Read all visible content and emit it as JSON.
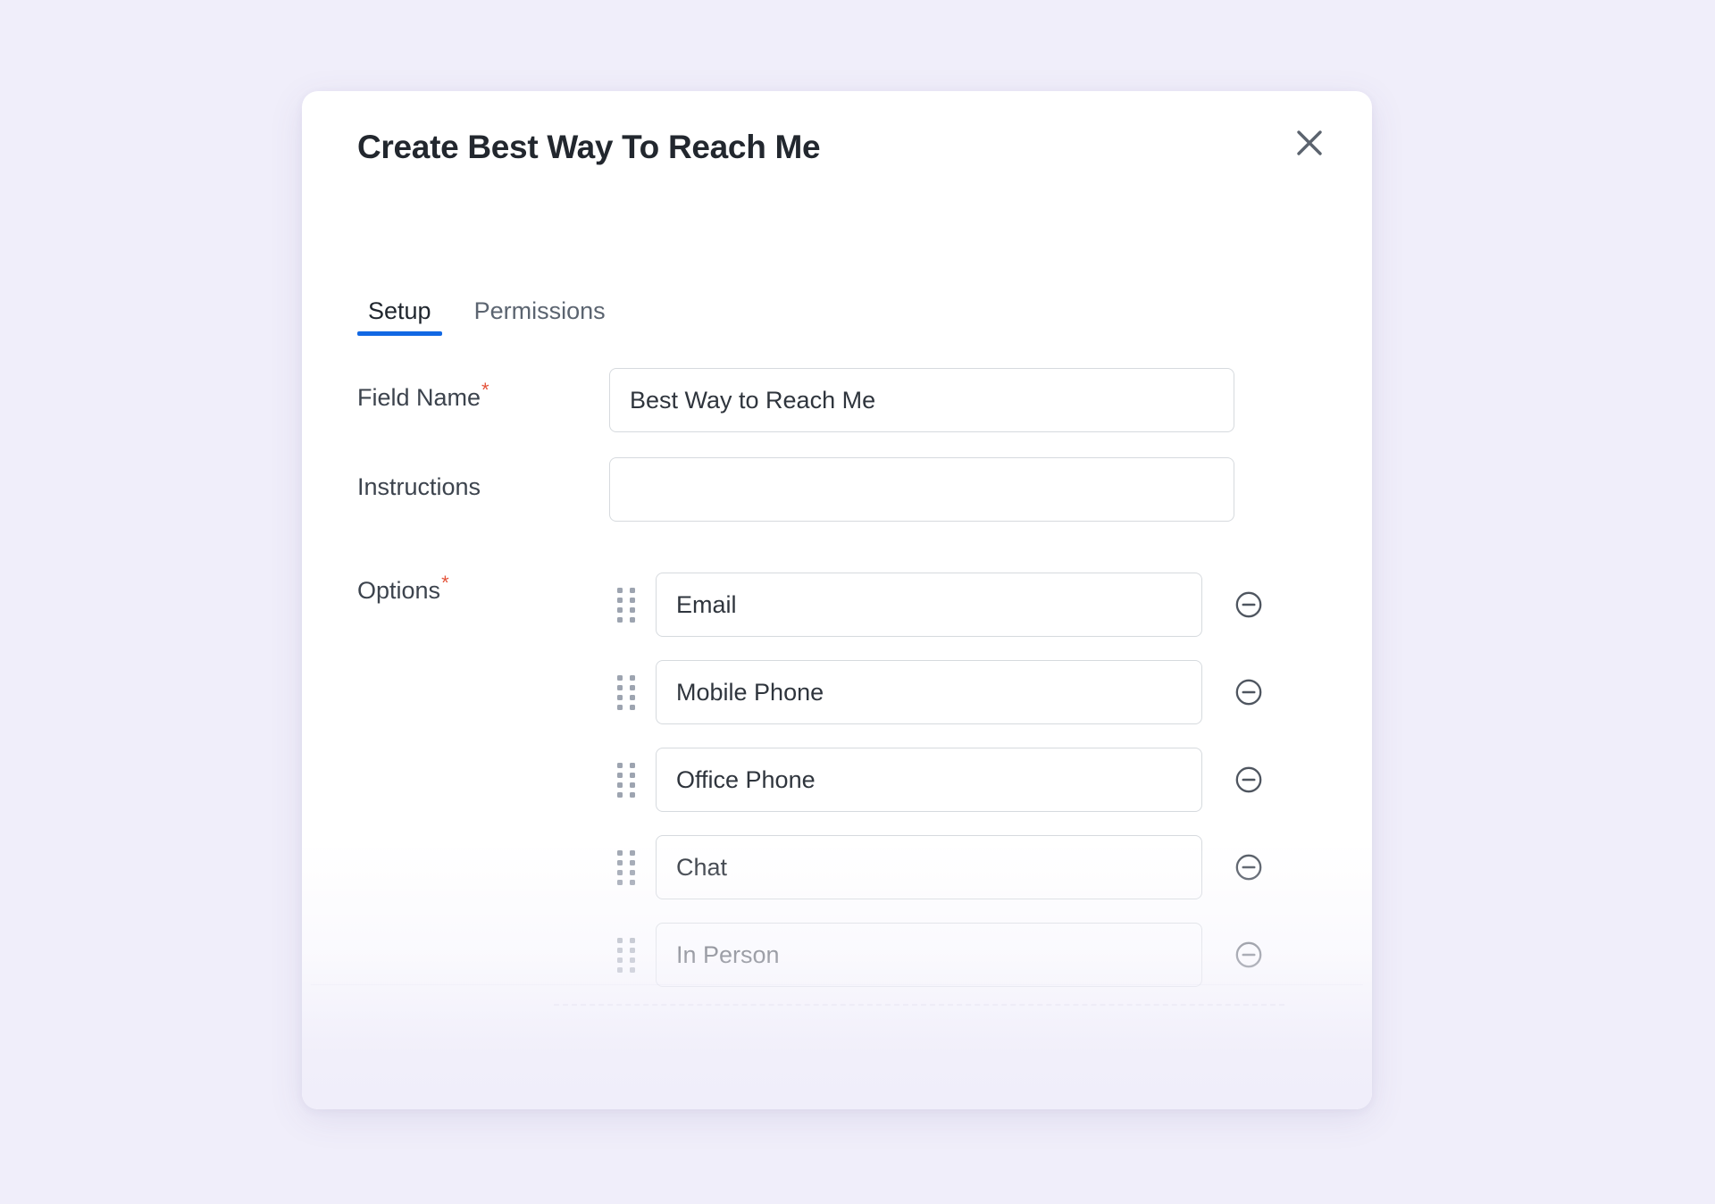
{
  "dialog": {
    "title": "Create Best Way To Reach Me",
    "close_label": "Close"
  },
  "tabs": [
    {
      "label": "Setup",
      "active": true
    },
    {
      "label": "Permissions",
      "active": false
    }
  ],
  "fields": {
    "field_name": {
      "label": "Field Name",
      "required": true,
      "required_marker": "*",
      "value": "Best Way to Reach Me",
      "placeholder": ""
    },
    "instructions": {
      "label": "Instructions",
      "required": false,
      "value": "",
      "placeholder": ""
    },
    "options": {
      "label": "Options",
      "required": true,
      "required_marker": "*",
      "items": [
        {
          "value": "Email"
        },
        {
          "value": "Mobile Phone"
        },
        {
          "value": "Office Phone"
        },
        {
          "value": "Chat"
        },
        {
          "value": "In Person"
        }
      ]
    }
  },
  "icons": {
    "close": "close-icon",
    "drag": "drag-handle-icon",
    "remove": "remove-circle-icon"
  },
  "colors": {
    "page_background": "#f0eefa",
    "modal_background": "#ffffff",
    "active_tab_underline": "#1268e3",
    "required_asterisk": "#e4533a",
    "input_border": "#d6dade",
    "title_text": "#22272e",
    "label_text": "#3c434d"
  }
}
